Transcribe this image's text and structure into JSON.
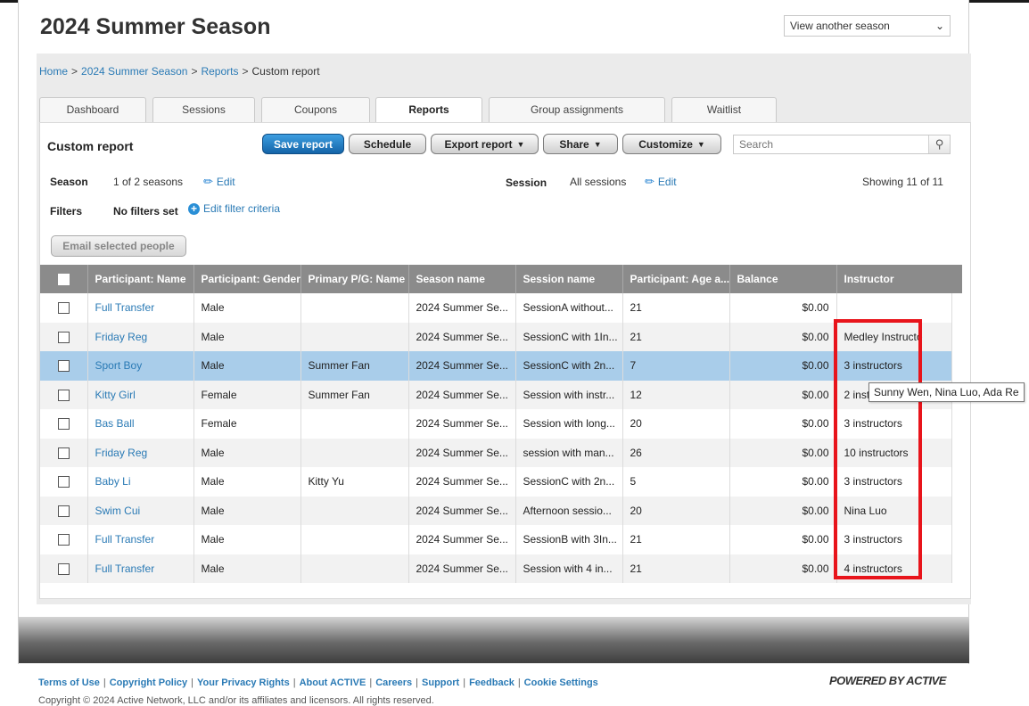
{
  "header": {
    "title": "2024 Summer Season",
    "season_select": "View another season"
  },
  "breadcrumb": {
    "items": [
      "Home",
      "2024 Summer Season",
      "Reports",
      "Custom report"
    ]
  },
  "tabs": [
    {
      "label": "Dashboard"
    },
    {
      "label": "Sessions"
    },
    {
      "label": "Coupons"
    },
    {
      "label": "Reports"
    },
    {
      "label": "Group assignments"
    },
    {
      "label": "Waitlist"
    }
  ],
  "report": {
    "title": "Custom report",
    "save_label": "Save report",
    "schedule_label": "Schedule",
    "export_label": "Export report",
    "share_label": "Share",
    "customize_label": "Customize",
    "search_placeholder": "Search",
    "season_label": "Season",
    "season_value": "1 of 2 seasons",
    "edit_label": "Edit",
    "session_label": "Session",
    "session_value": "All sessions",
    "showing": "Showing 11 of 11",
    "filters_label": "Filters",
    "filters_value": "No filters set",
    "edit_filter_label": "Edit filter criteria",
    "email_label": "Email selected people"
  },
  "table": {
    "columns": [
      "Participant: Name",
      "Participant: Gender",
      "Primary P/G: Name",
      "Season name",
      "Session name",
      "Participant: Age a...",
      "Balance",
      "Instructor"
    ],
    "rows": [
      {
        "name": "Full Transfer",
        "gender": "Male",
        "pg": "",
        "season": "2024 Summer Se...",
        "session": "SessionA without...",
        "age": "21",
        "balance": "$0.00",
        "instructor": ""
      },
      {
        "name": "Friday Reg",
        "gender": "Male",
        "pg": "",
        "season": "2024 Summer Se...",
        "session": "SessionC with 1In...",
        "age": "21",
        "balance": "$0.00",
        "instructor": "Medley Instructo"
      },
      {
        "name": "Sport Boy",
        "gender": "Male",
        "pg": "Summer Fan",
        "season": "2024 Summer Se...",
        "session": "SessionC with 2n...",
        "age": "7",
        "balance": "$0.00",
        "instructor": "3 instructors"
      },
      {
        "name": "Kitty Girl",
        "gender": "Female",
        "pg": "Summer Fan",
        "season": "2024 Summer Se...",
        "session": "Session with instr...",
        "age": "12",
        "balance": "$0.00",
        "instructor": "2 inst"
      },
      {
        "name": "Bas Ball",
        "gender": "Female",
        "pg": "",
        "season": "2024 Summer Se...",
        "session": "Session with long...",
        "age": "20",
        "balance": "$0.00",
        "instructor": "3 instructors"
      },
      {
        "name": "Friday Reg",
        "gender": "Male",
        "pg": "",
        "season": "2024 Summer Se...",
        "session": "session with man...",
        "age": "26",
        "balance": "$0.00",
        "instructor": "10 instructors"
      },
      {
        "name": "Baby Li",
        "gender": "Male",
        "pg": "Kitty Yu",
        "season": "2024 Summer Se...",
        "session": "SessionC with 2n...",
        "age": "5",
        "balance": "$0.00",
        "instructor": "3 instructors"
      },
      {
        "name": "Swim Cui",
        "gender": "Male",
        "pg": "",
        "season": "2024 Summer Se...",
        "session": "Afternoon sessio...",
        "age": "20",
        "balance": "$0.00",
        "instructor": "Nina Luo"
      },
      {
        "name": "Full Transfer",
        "gender": "Male",
        "pg": "",
        "season": "2024 Summer Se...",
        "session": "SessionB with 3In...",
        "age": "21",
        "balance": "$0.00",
        "instructor": "3 instructors"
      },
      {
        "name": "Full Transfer",
        "gender": "Male",
        "pg": "",
        "season": "2024 Summer Se...",
        "session": "Session with 4 in...",
        "age": "21",
        "balance": "$0.00",
        "instructor": "4 instructors"
      }
    ],
    "selected_row": 2
  },
  "tooltip": "Sunny Wen, Nina Luo, Ada Re",
  "footer": {
    "links": [
      "Terms of Use",
      "Copyright Policy",
      "Your Privacy Rights",
      "About ACTIVE",
      "Careers",
      "Support",
      "Feedback",
      "Cookie Settings"
    ],
    "powered_by": "POWERED BY ACTIVE",
    "copyright": "Copyright © 2024 Active Network, LLC and/or its affiliates and licensors. All rights reserved."
  },
  "colors": {
    "link": "#2a7ab5",
    "header_gray": "#8b8b8b",
    "selected_row": "#a9cdea",
    "highlight": "#e8141b",
    "primary_button": "#1a76c0"
  }
}
